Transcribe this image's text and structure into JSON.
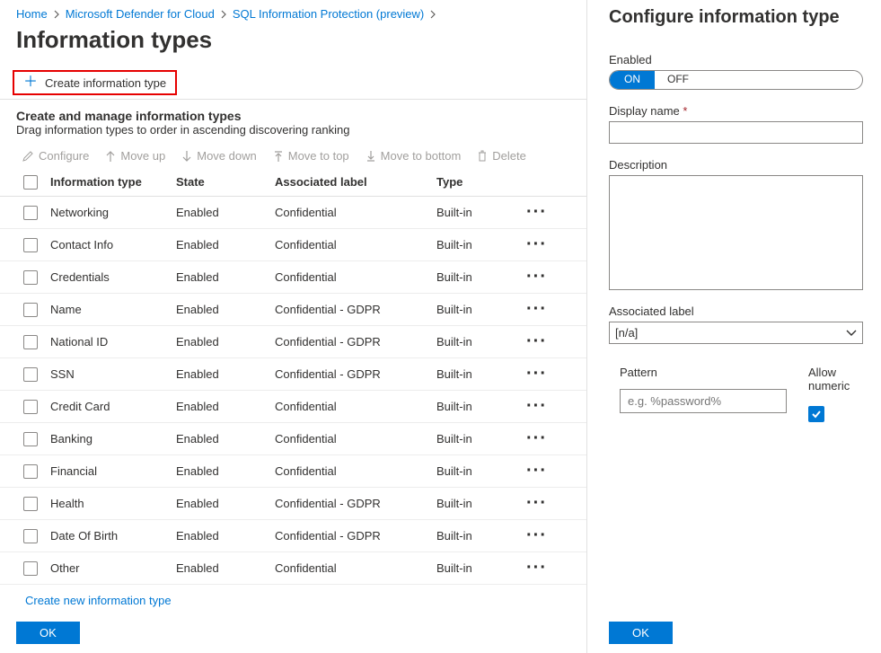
{
  "breadcrumb": {
    "items": [
      "Home",
      "Microsoft Defender for Cloud",
      "SQL Information Protection (preview)"
    ]
  },
  "page": {
    "title": "Information types"
  },
  "createBtn": {
    "label": "Create information type"
  },
  "section": {
    "title": "Create and manage information types",
    "subtitle": "Drag information types to order in ascending discovering ranking"
  },
  "actions": {
    "configure": "Configure",
    "moveUp": "Move up",
    "moveDown": "Move down",
    "moveTop": "Move to top",
    "moveBottom": "Move to bottom",
    "delete": "Delete"
  },
  "table": {
    "headers": {
      "name": "Information type",
      "state": "State",
      "label": "Associated label",
      "type": "Type"
    },
    "rows": [
      {
        "name": "Networking",
        "state": "Enabled",
        "label": "Confidential",
        "type": "Built-in"
      },
      {
        "name": "Contact Info",
        "state": "Enabled",
        "label": "Confidential",
        "type": "Built-in"
      },
      {
        "name": "Credentials",
        "state": "Enabled",
        "label": "Confidential",
        "type": "Built-in"
      },
      {
        "name": "Name",
        "state": "Enabled",
        "label": "Confidential - GDPR",
        "type": "Built-in"
      },
      {
        "name": "National ID",
        "state": "Enabled",
        "label": "Confidential - GDPR",
        "type": "Built-in"
      },
      {
        "name": "SSN",
        "state": "Enabled",
        "label": "Confidential - GDPR",
        "type": "Built-in"
      },
      {
        "name": "Credit Card",
        "state": "Enabled",
        "label": "Confidential",
        "type": "Built-in"
      },
      {
        "name": "Banking",
        "state": "Enabled",
        "label": "Confidential",
        "type": "Built-in"
      },
      {
        "name": "Financial",
        "state": "Enabled",
        "label": "Confidential",
        "type": "Built-in"
      },
      {
        "name": "Health",
        "state": "Enabled",
        "label": "Confidential - GDPR",
        "type": "Built-in"
      },
      {
        "name": "Date Of Birth",
        "state": "Enabled",
        "label": "Confidential - GDPR",
        "type": "Built-in"
      },
      {
        "name": "Other",
        "state": "Enabled",
        "label": "Confidential",
        "type": "Built-in"
      }
    ]
  },
  "createLink": "Create new information type",
  "okLabel": "OK",
  "side": {
    "title": "Configure information type",
    "enabled": "Enabled",
    "on": "ON",
    "off": "OFF",
    "displayName": "Display name",
    "description": "Description",
    "associatedLabel": "Associated label",
    "selectedLabel": "[n/a]",
    "pattern": "Pattern",
    "patternPlaceholder": "e.g. %password%",
    "allowNumeric": "Allow numeric"
  }
}
